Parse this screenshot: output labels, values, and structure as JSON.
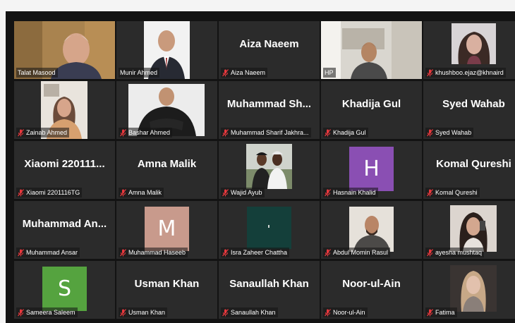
{
  "meeting": {
    "active_speaker_color": "#f7e23b",
    "mute_icon": "muted-microphone-icon",
    "mute_color": "#e8383d",
    "participants": [
      {
        "label": "Talat Masood",
        "video": "video-feed-talat-masood",
        "muted": false
      },
      {
        "label": "Munir Ahmed",
        "video": "video-feed-munir-ahmed",
        "muted": false
      },
      {
        "label": "Aiza Naeem",
        "display_name": "Aiza Naeem",
        "muted": true
      },
      {
        "label": "HP",
        "video": "video-feed-hp",
        "muted": false
      },
      {
        "label": "khushboo.ejaz@khnaird",
        "video": "video-feed-khushboo",
        "muted": true
      },
      {
        "label": "Zainab Ahmed",
        "video": "video-feed-zainab-ahmed",
        "muted": true
      },
      {
        "label": "Bashar Ahmed",
        "video": "video-feed-bashar-ahmed",
        "muted": true
      },
      {
        "label": "Muhammad Sharif Jakhra...",
        "display_name": "Muhammad Sh...",
        "muted": true
      },
      {
        "label": "Khadija Gul",
        "display_name": "Khadija Gul",
        "muted": true
      },
      {
        "label": "Syed Wahab",
        "display_name": "Syed Wahab",
        "muted": true
      },
      {
        "label": "Xiaomi 2201116TG",
        "display_name": "Xiaomi 220111...",
        "muted": true
      },
      {
        "label": "Amna Malik",
        "display_name": "Amna Malik",
        "muted": true
      },
      {
        "label": "Wajid Ayub",
        "video": "video-feed-wajid-ayub",
        "muted": true
      },
      {
        "label": "Hasnain Khalid",
        "avatar_letter": "H",
        "avatar_color": "#8a4fb3",
        "muted": true
      },
      {
        "label": "Komal Qureshi",
        "display_name": "Komal Qureshi",
        "muted": true
      },
      {
        "label": "Muhammad Ansar",
        "display_name": "Muhammad An...",
        "muted": true
      },
      {
        "label": "Muhammad Haseeb",
        "avatar_letter": "M",
        "avatar_color": "#c89a8c",
        "muted": true
      },
      {
        "label": "Isra Zaheer Chattha",
        "video": "video-feed-isra-zaheer",
        "muted": true
      },
      {
        "label": "Abdul Momin Rasul",
        "video": "video-feed-abdul-momin",
        "muted": true
      },
      {
        "label": "ayesha mushtaq",
        "video": "video-feed-ayesha-mushtaq",
        "muted": true
      },
      {
        "label": "Sameera Saleem",
        "avatar_letter": "S",
        "avatar_color": "#55a33f",
        "muted": true
      },
      {
        "label": "Usman Khan",
        "display_name": "Usman Khan",
        "muted": true
      },
      {
        "label": "Sanaullah Khan",
        "display_name": "Sanaullah Khan",
        "muted": true
      },
      {
        "label": "Noor-ul-Ain",
        "display_name": "Noor-ul-Ain",
        "muted": true
      },
      {
        "label": "Fatima",
        "video": "video-feed-fatima",
        "muted": true
      }
    ]
  }
}
